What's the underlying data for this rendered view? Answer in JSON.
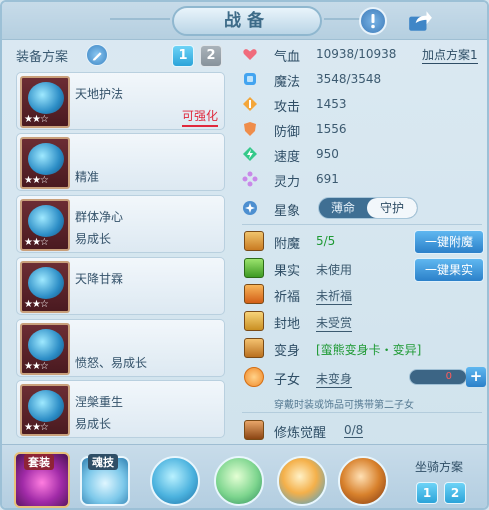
{
  "window": {
    "title": "战备"
  },
  "left": {
    "plan_label": "装备方案",
    "plan_tabs": [
      "1",
      "2"
    ],
    "equipment": [
      {
        "name": "天地护法",
        "sub": "",
        "action": "可强化",
        "stars": "★★☆"
      },
      {
        "name": "",
        "sub": "精准",
        "action": "",
        "stars": "★★☆"
      },
      {
        "name": "群体净心",
        "sub": "易成长",
        "action": "",
        "stars": "★★☆"
      },
      {
        "name": "天降甘霖",
        "sub": "",
        "action": "",
        "stars": "★★☆"
      },
      {
        "name": "",
        "sub": "愤怒、易成长",
        "action": "",
        "stars": "★★☆"
      },
      {
        "name": "涅槃重生",
        "sub": "易成长",
        "action": "",
        "stars": "★★☆"
      }
    ]
  },
  "stats": [
    {
      "name": "气血",
      "value": "10938/10938",
      "icon": "heart-icon",
      "color": "#f06b7c"
    },
    {
      "name": "魔法",
      "value": "3548/3548",
      "icon": "mana-icon",
      "color": "#43a4f0"
    },
    {
      "name": "攻击",
      "value": "1453",
      "icon": "attack-icon",
      "color": "#f3a63a"
    },
    {
      "name": "防御",
      "value": "1556",
      "icon": "defense-icon",
      "color": "#ef8d4a"
    },
    {
      "name": "速度",
      "value": "950",
      "icon": "speed-icon",
      "color": "#35c98a"
    },
    {
      "name": "灵力",
      "value": "691",
      "icon": "spirit-icon",
      "color": "#c889e8"
    }
  ],
  "add_plan": "加点方案1",
  "star_sign": {
    "label": "星象",
    "options": [
      "薄命",
      "守护"
    ],
    "selected": "守护"
  },
  "misc": [
    {
      "name": "附魔",
      "value": "5/5",
      "style": "green"
    },
    {
      "name": "果实",
      "value": "未使用",
      "style": "plain"
    },
    {
      "name": "祈福",
      "value": "未祈福",
      "style": "u"
    },
    {
      "name": "封地",
      "value": "未受赏",
      "style": "u"
    },
    {
      "name": "变身",
      "value": "[蛮熊变身卡・变异]",
      "style": "green"
    },
    {
      "name": "子女",
      "value": "未变身",
      "style": "u"
    }
  ],
  "buttons": {
    "enchant": "一键附魔",
    "fruit": "一键果实"
  },
  "child_value": "0",
  "hint": "穿戴时装或饰品可携带第二子女",
  "cultivate": {
    "name": "修炼觉醒",
    "value": "0/8"
  },
  "bottom": {
    "suit_tag": "套装",
    "skill_tag": "魂技",
    "mount_label": "坐骑方案",
    "mount_tabs": [
      "1",
      "2"
    ]
  }
}
